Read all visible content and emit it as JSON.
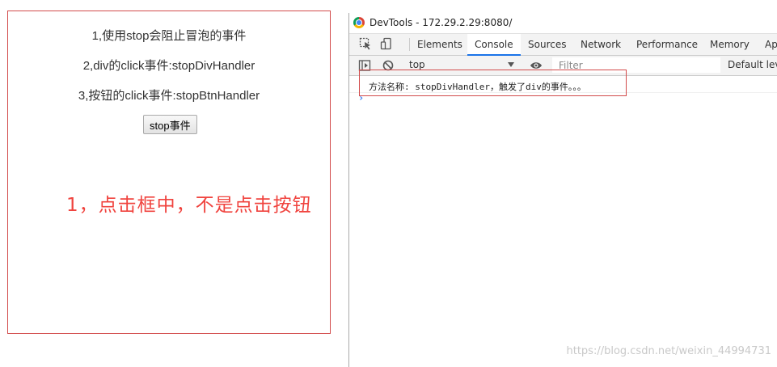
{
  "demo": {
    "line1": "1,使用stop会阻止冒泡的事件",
    "line2": "2,div的click事件:stopDivHandler",
    "line3": "3,按钮的click事件:stopBtnHandler",
    "button_label": "stop事件",
    "annotation": "1，点击框中，不是点击按钮",
    "border_color": "#d24b4b",
    "annotation_color": "#f0433e"
  },
  "devtools": {
    "title": "DevTools - 172.29.2.29:8080/",
    "tabs": [
      "Elements",
      "Console",
      "Sources",
      "Network",
      "Performance",
      "Memory",
      "Ap"
    ],
    "active_tab": "Console",
    "context": "top",
    "filter_placeholder": "Filter",
    "levels_label": "Default levels",
    "log_message": "方法名称: stopDivHandler，触发了div的事件。。。",
    "prompt_symbol": "›",
    "accent_color": "#1a73e8",
    "icons": [
      "chrome-icon",
      "inspect-icon",
      "device-toggle-icon",
      "sidebar-toggle-icon",
      "clear-console-icon",
      "eye-icon",
      "dropdown-arrow-icon"
    ]
  },
  "watermark": "https://blog.csdn.net/weixin_44994731"
}
